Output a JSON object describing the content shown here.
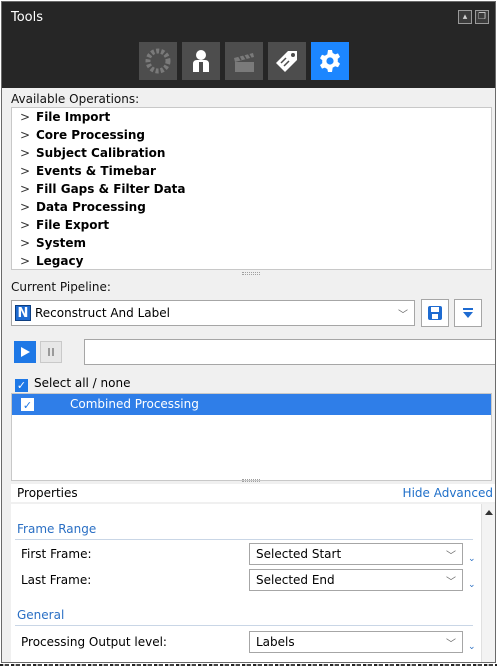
{
  "panel": {
    "title": "Tools",
    "window_buttons": [
      "pin-icon",
      "restore-icon"
    ],
    "toolbar_icons": [
      {
        "name": "marker-icon",
        "active": false
      },
      {
        "name": "subject-icon",
        "active": true,
        "style": "white"
      },
      {
        "name": "clapper-icon",
        "active": false
      },
      {
        "name": "label-tag-icon",
        "active": false,
        "style": "white"
      },
      {
        "name": "gear-icon",
        "active": true,
        "selected": true
      }
    ],
    "accent": "#1e78e6"
  },
  "operations": {
    "label": "Available Operations:",
    "items": [
      "File Import",
      "Core Processing",
      "Subject Calibration",
      "Events & Timebar",
      "Fill Gaps & Filter Data",
      "Data Processing",
      "File Export",
      "System",
      "Legacy"
    ]
  },
  "pipeline": {
    "label": "Current Pipeline:",
    "selected": "Reconstruct And Label",
    "progress_value": "",
    "select_all_label": "Select all / none",
    "select_all_checked": true,
    "items": [
      {
        "label": "Combined Processing",
        "checked": true,
        "selected": true
      }
    ]
  },
  "properties": {
    "label": "Properties",
    "hide_advanced": "Hide Advanced",
    "groups": [
      {
        "name": "Frame Range",
        "rows": [
          {
            "label": "First Frame:",
            "value": "Selected Start"
          },
          {
            "label": "Last Frame:",
            "value": "Selected End"
          }
        ]
      },
      {
        "name": "General",
        "rows": [
          {
            "label": "Processing Output level:",
            "value": "Labels"
          }
        ]
      }
    ]
  }
}
